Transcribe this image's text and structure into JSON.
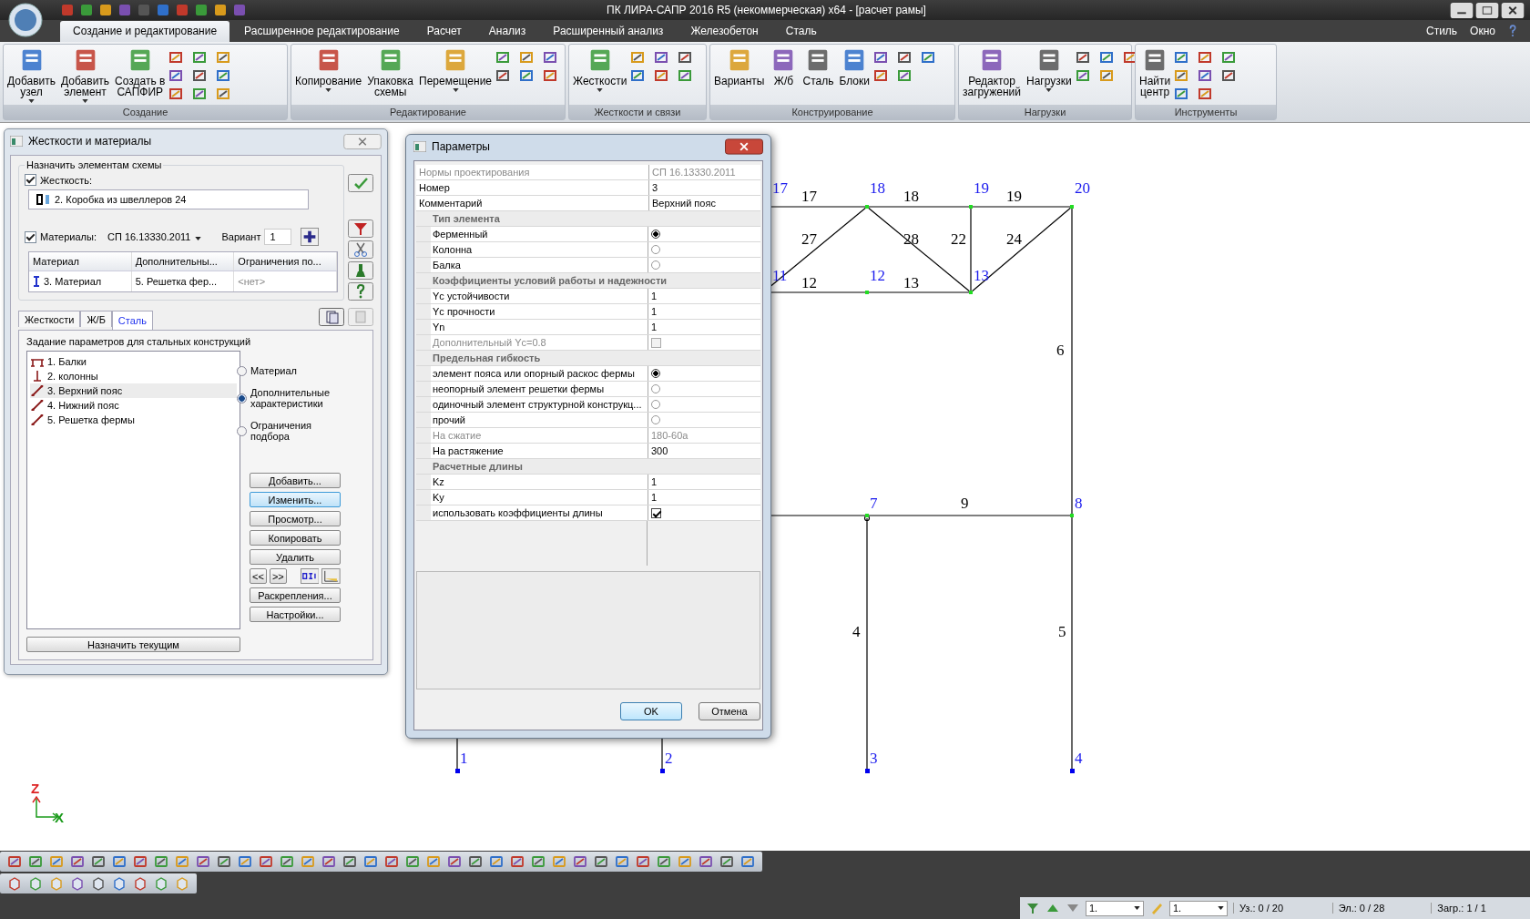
{
  "window": {
    "title": "ПК ЛИРА-САПР  2016 R5 (некоммерческая) x64 - [расчет рамы]"
  },
  "menu": {
    "tabs": [
      {
        "label": "Создание и редактирование",
        "selected": true
      },
      {
        "label": "Расширенное редактирование",
        "selected": false
      },
      {
        "label": "Расчет",
        "selected": false
      },
      {
        "label": "Анализ",
        "selected": false
      },
      {
        "label": "Расширенный анализ",
        "selected": false
      },
      {
        "label": "Железобетон",
        "selected": false
      },
      {
        "label": "Сталь",
        "selected": false
      }
    ],
    "right": [
      "Стиль",
      "Окно"
    ]
  },
  "ribbon": {
    "groups": [
      {
        "title": "Создание",
        "buttons": [
          {
            "lines": [
              "Добавить",
              "узел"
            ],
            "dropdown": true
          },
          {
            "lines": [
              "Добавить",
              "элемент"
            ],
            "dropdown": true
          },
          {
            "lines": [
              "Создать в",
              "САПФИР"
            ],
            "dropdown": false
          }
        ]
      },
      {
        "title": "Редактирование",
        "buttons": [
          {
            "lines": [
              "Копирование"
            ],
            "dropdown": true
          },
          {
            "lines": [
              "Упаковка",
              "схемы"
            ],
            "dropdown": false
          },
          {
            "lines": [
              "Перемещение"
            ],
            "dropdown": true
          }
        ]
      },
      {
        "title": "Жесткости и связи",
        "buttons": [
          {
            "lines": [
              "Жесткости"
            ],
            "dropdown": true
          }
        ]
      },
      {
        "title": "Конструирование",
        "buttons": [
          {
            "lines": [
              "Варианты"
            ],
            "dropdown": false
          },
          {
            "lines": [
              "Ж/б"
            ],
            "dropdown": false
          },
          {
            "lines": [
              "Сталь"
            ],
            "dropdown": false
          },
          {
            "lines": [
              "Блоки"
            ],
            "dropdown": false
          }
        ]
      },
      {
        "title": "Нагрузки",
        "buttons": [
          {
            "lines": [
              "Редактор",
              "загружений"
            ],
            "dropdown": false
          },
          {
            "lines": [
              "Нагрузки"
            ],
            "dropdown": true
          }
        ]
      },
      {
        "title": "Инструменты",
        "buttons": [
          {
            "lines": [
              "Найти",
              "центр"
            ],
            "dropdown": false
          }
        ]
      }
    ]
  },
  "stiffness_panel": {
    "title": "Жесткости и материалы",
    "group_title": "Назначить элементам схемы",
    "stiffness": {
      "label": "Жесткость:",
      "checked": true,
      "value": "2. Коробка из швеллеров 24"
    },
    "materials": {
      "label": "Материалы:",
      "checked": true,
      "norm": "СП 16.13330.2011",
      "variant_label": "Вариант",
      "variant": "1"
    },
    "table": {
      "columns": [
        "Материал",
        "Дополнительны...",
        "Ограничения по..."
      ],
      "row": [
        "3. Материал",
        "5. Решетка фер...",
        "<нет>"
      ]
    },
    "tabs": [
      {
        "label": "Жесткости",
        "selected": false
      },
      {
        "label": "Ж/Б",
        "selected": false
      },
      {
        "label": "Сталь",
        "selected": true
      }
    ],
    "section_title": "Задание параметров для стальных конструкций",
    "items": [
      {
        "label": "1. Балки",
        "kind": "beam",
        "selected": false
      },
      {
        "label": "2. колонны",
        "kind": "column",
        "selected": false
      },
      {
        "label": "3. Верхний пояс",
        "kind": "rod",
        "selected": true
      },
      {
        "label": "4. Нижний пояс",
        "kind": "rod",
        "selected": false
      },
      {
        "label": "5. Решетка фермы",
        "kind": "rod",
        "selected": false
      }
    ],
    "radios": [
      {
        "label": "Материал",
        "selected": false
      },
      {
        "label": "Дополнительные характеристики",
        "selected": true
      },
      {
        "label": "Ограничения подбора",
        "selected": false
      }
    ],
    "buttons": [
      {
        "label": "Добавить...",
        "focused": false
      },
      {
        "label": "Изменить...",
        "focused": true
      },
      {
        "label": "Просмотр...",
        "focused": false
      },
      {
        "label": "Копировать",
        "focused": false
      },
      {
        "label": "Удалить",
        "focused": false
      }
    ],
    "nav": [
      "<<",
      ">>"
    ],
    "buttons_after": [
      "Раскрепления...",
      "Настройки..."
    ],
    "assign_button": "Назначить текущим"
  },
  "params_dialog": {
    "title": "Параметры",
    "top_rows": [
      {
        "label": "Нормы проектирования",
        "value": "СП 16.13330.2011",
        "disabled": true
      },
      {
        "label": "Номер",
        "value": "3",
        "disabled": false
      },
      {
        "label": "Комментарий",
        "value": "Верхний пояс",
        "disabled": false
      }
    ],
    "categories": [
      {
        "label": "Тип элемента",
        "rows": [
          {
            "kind": "radio",
            "label": "Ферменный",
            "selected": true
          },
          {
            "kind": "radio",
            "label": "Колонна",
            "selected": false
          },
          {
            "kind": "radio",
            "label": "Балка",
            "selected": false
          }
        ]
      },
      {
        "label": "Коэффициенты условий работы и надежности",
        "rows": [
          {
            "kind": "field",
            "label": "Yc устойчивости",
            "value": "1",
            "disabled": false
          },
          {
            "kind": "field",
            "label": "Yc прочности",
            "value": "1",
            "disabled": false
          },
          {
            "kind": "field",
            "label": "Yn",
            "value": "1",
            "disabled": false
          },
          {
            "kind": "checkbox",
            "label": "Дополнительный Yc=0.8",
            "checked": false,
            "disabled": true
          }
        ]
      },
      {
        "label": "Предельная гибкость",
        "rows": [
          {
            "kind": "radio",
            "label": "элемент пояса или опорный раскос фермы",
            "selected": true
          },
          {
            "kind": "radio",
            "label": "неопорный элемент решетки фермы",
            "selected": false
          },
          {
            "kind": "radio",
            "label": "одиночный элемент структурной конструкц...",
            "selected": false
          },
          {
            "kind": "radio",
            "label": "прочий",
            "selected": false
          },
          {
            "kind": "field",
            "label": "На сжатие",
            "value": "180-60a",
            "disabled": true
          },
          {
            "kind": "field",
            "label": "На растяжение",
            "value": "300",
            "disabled": false
          }
        ]
      },
      {
        "label": "Расчетные длины",
        "rows": [
          {
            "kind": "field",
            "label": "Kz",
            "value": "1",
            "disabled": false
          },
          {
            "kind": "field",
            "label": "Ky",
            "value": "1",
            "disabled": false
          },
          {
            "kind": "checkbox",
            "label": "использовать коэффициенты длины",
            "checked": true,
            "disabled": false
          }
        ]
      }
    ],
    "buttons": [
      {
        "label": "OK",
        "default": true
      },
      {
        "label": "Отмена",
        "default": false
      }
    ]
  },
  "canvas": {
    "node_labels": [
      "17",
      "18",
      "19",
      "20",
      "11",
      "12",
      "13",
      "7",
      "8",
      "1",
      "2",
      "3",
      "4"
    ],
    "element_labels": [
      "17",
      "18",
      "19",
      "27",
      "28",
      "22",
      "24",
      "12",
      "13",
      "6",
      "9",
      "4",
      "5"
    ],
    "axes": [
      "Z",
      "X"
    ]
  },
  "status_bar": {
    "selectors": [
      "1.",
      "1."
    ],
    "counters": [
      "Уз.: 0 / 20",
      "Эл.: 0 / 28",
      "Загр.: 1 / 1"
    ]
  }
}
